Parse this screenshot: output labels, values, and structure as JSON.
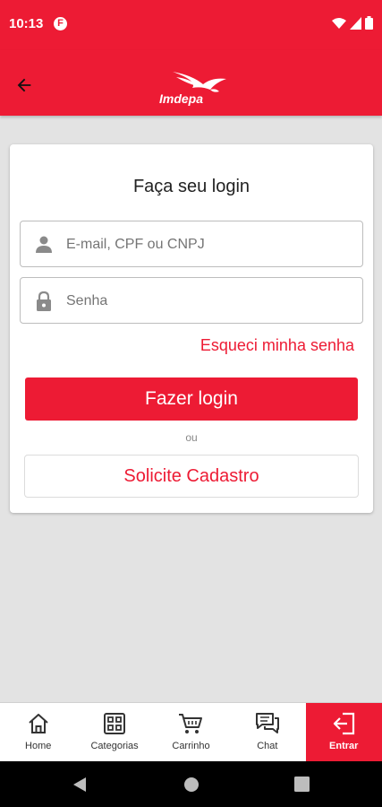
{
  "status_bar": {
    "time": "10:13",
    "app_icon_letter": "F",
    "icons": [
      "wifi-icon",
      "signal-icon",
      "battery-icon"
    ]
  },
  "header": {
    "logo_text": "Imdepa",
    "back_icon": "arrow-left-icon"
  },
  "login": {
    "title": "Faça seu login",
    "email_placeholder": "E-mail, CPF ou CNPJ",
    "email_value": "",
    "password_placeholder": "Senha",
    "password_value": "",
    "forgot_label": "Esqueci minha senha",
    "login_label": "Fazer login",
    "or_label": "ou",
    "register_label": "Solicite Cadastro"
  },
  "bottom_nav": {
    "items": [
      {
        "label": "Home",
        "icon": "home-icon",
        "active": false
      },
      {
        "label": "Categorias",
        "icon": "grid-icon",
        "active": false
      },
      {
        "label": "Carrinho",
        "icon": "cart-icon",
        "active": false
      },
      {
        "label": "Chat",
        "icon": "chat-icon",
        "active": false
      },
      {
        "label": "Entrar",
        "icon": "login-icon",
        "active": true
      }
    ]
  },
  "colors": {
    "brand": "#ed1b34",
    "background": "#e3e3e3"
  }
}
